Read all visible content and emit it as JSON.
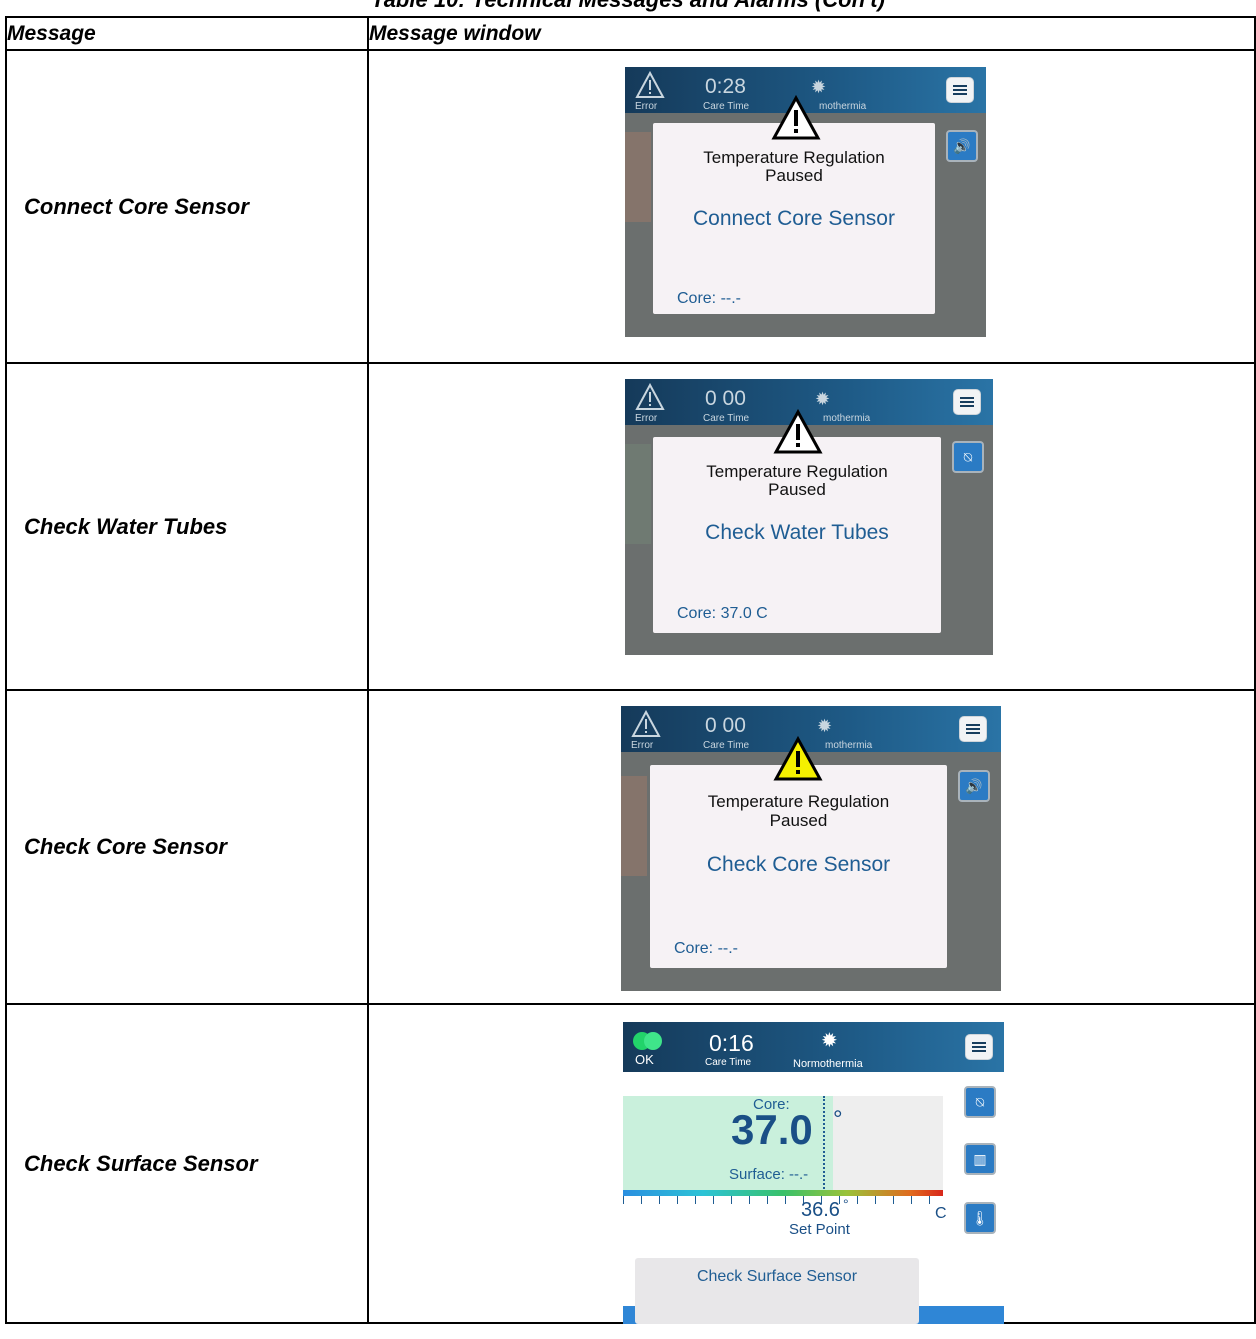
{
  "caption": "Table 10: Technical Messages and Alarms (Con't)",
  "headers": {
    "message": "Message",
    "window": "Message window"
  },
  "rows": [
    {
      "label": "Connect Core Sensor",
      "status": "Error",
      "time": "0:28",
      "care_time": "Care Time",
      "mode": "mothermia",
      "title_line1": "Temperature Regulation",
      "title_line2": "Paused",
      "popup_message": "Connect Core Sensor",
      "core_text": "Core: --.-",
      "triangle_color": "#ffffff",
      "side_icon": "speaker-icon"
    },
    {
      "label": "Check Water Tubes",
      "status": "Error",
      "time": "0 00",
      "care_time": "Care Time",
      "mode": "mothermia",
      "title_line1": "Temperature Regulation",
      "title_line2": "Paused",
      "popup_message": "Check Water Tubes",
      "core_text": "Core: 37.0 C",
      "triangle_color": "#ffffff",
      "side_icon": "alarm-muted-icon"
    },
    {
      "label": "Check Core Sensor",
      "status": "Error",
      "time": "0 00",
      "care_time": "Care Time",
      "mode": "mothermia",
      "title_line1": "Temperature Regulation",
      "title_line2": "Paused",
      "popup_message": "Check Core Sensor",
      "core_text": "Core: --.-",
      "triangle_color": "#f5f000",
      "side_icon": "speaker-icon"
    },
    {
      "label": "Check Surface Sensor",
      "status": "OK",
      "time": "0:16",
      "care_time": "Care Time",
      "mode": "Normothermia",
      "core_label": "Core:",
      "core_value": "37.0",
      "degree": "°",
      "surface_label": "Surface: --.-",
      "setpoint_value": "36.6",
      "setpoint_label": "Set Point",
      "unit": "C",
      "popup_message": "Check Surface Sensor"
    }
  ]
}
